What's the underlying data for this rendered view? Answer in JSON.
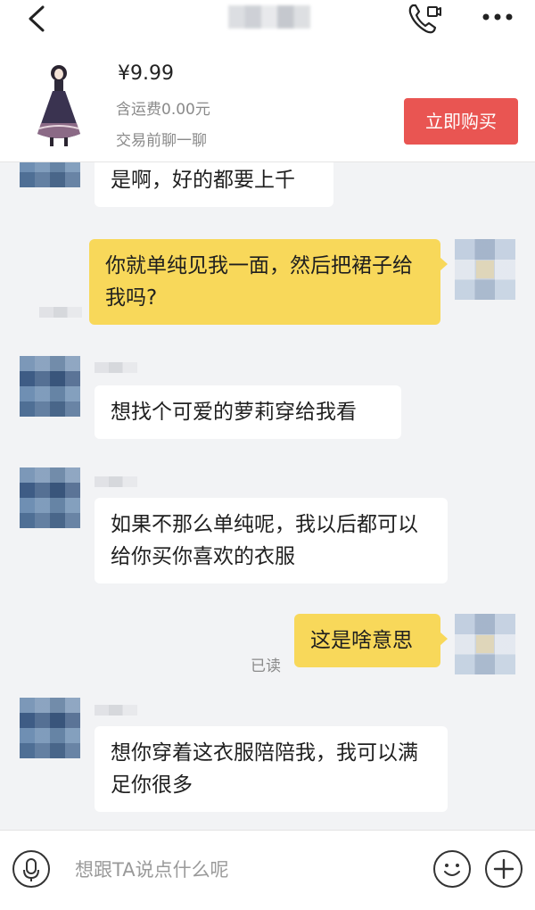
{
  "header": {
    "back_icon": "chevron-left-icon",
    "call_icon": "phone-icon",
    "more_icon": "more-dots-icon"
  },
  "product": {
    "price": "¥9.99",
    "shipping": "含运费0.00元",
    "chat_hint": "交易前聊一聊",
    "buy_button": "立即购买",
    "accent": "#e95552"
  },
  "messages": [
    {
      "from": "other",
      "text": "是啊，好的都要上千"
    },
    {
      "from": "me",
      "text": "你就单纯见我一面，然后把裙子给我吗?"
    },
    {
      "from": "other",
      "text": "想找个可爱的萝莉穿给我看"
    },
    {
      "from": "other",
      "text": "如果不那么单纯呢，我以后都可以给你买你喜欢的衣服"
    },
    {
      "from": "me",
      "text": "这是啥意思",
      "status": "已读"
    },
    {
      "from": "other",
      "text": "想你穿着这衣服陪陪我，我可以满足你很多"
    }
  ],
  "input": {
    "placeholder": "想跟TA说点什么呢",
    "voice_icon": "microphone-icon",
    "emoji_icon": "smiley-icon",
    "add_icon": "plus-icon"
  },
  "colors": {
    "outgoing_bubble": "#f8d85a",
    "incoming_bubble": "#ffffff",
    "background": "#f2f3f5"
  }
}
